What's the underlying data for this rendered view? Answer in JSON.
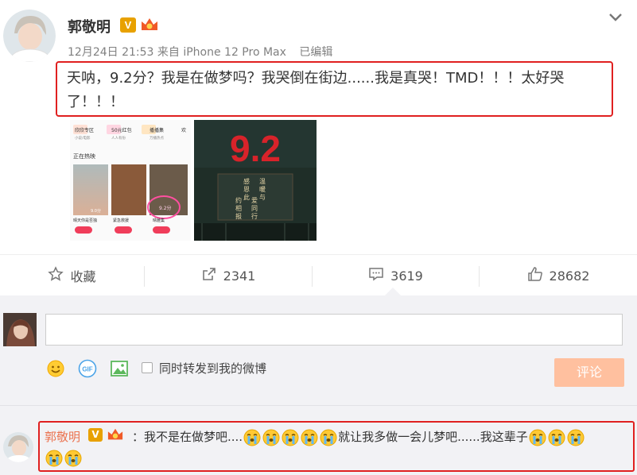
{
  "post": {
    "author": "郭敬明",
    "verified_badge": "V",
    "timestamp": "12月24日 21:53",
    "source": "来自 iPhone 12 Pro Max",
    "edited": "已编辑",
    "text": "天呐，9.2分？我是在做梦吗？我哭倒在街边......我是真哭！TMD！！！太好哭了！！！",
    "images": [
      {
        "type": "app-screenshot",
        "tabs": [
          "欣欣专区",
          "50元红包",
          "播播集",
          "欢"
        ],
        "tab_subs": [
          "小说/电影",
          "人人有份",
          "万播热点"
        ],
        "section_title": "正在热映",
        "movies": [
          "晴天你是否独",
          "紧急救援",
          "晴雅集"
        ],
        "ratings": [
          "9.0分",
          "9.2分"
        ]
      },
      {
        "type": "poster",
        "score": "9.2",
        "verse": [
          "温",
          "暖",
          "与",
          "爱",
          "同",
          "行"
        ],
        "verse2": [
          "感",
          "恩",
          "此",
          "约",
          "相",
          "报"
        ]
      }
    ]
  },
  "actions": {
    "favorite": "收藏",
    "repost_count": "2341",
    "comment_count": "3619",
    "like_count": "28682"
  },
  "comment_box": {
    "repost_option": "同时转发到我的微博",
    "submit": "评论"
  },
  "reply": {
    "author": "郭敬明",
    "verified_badge": "V",
    "prefix": "：我不是在做梦吧....",
    "middle": "就让我多做一会儿梦吧......我这辈子",
    "emoji_name": "crying-face"
  },
  "colors": {
    "highlight_border": "#e02020",
    "name_orange": "#eb7350",
    "badge_gold": "#e8a100",
    "button_disabled": "#ffc09f"
  }
}
